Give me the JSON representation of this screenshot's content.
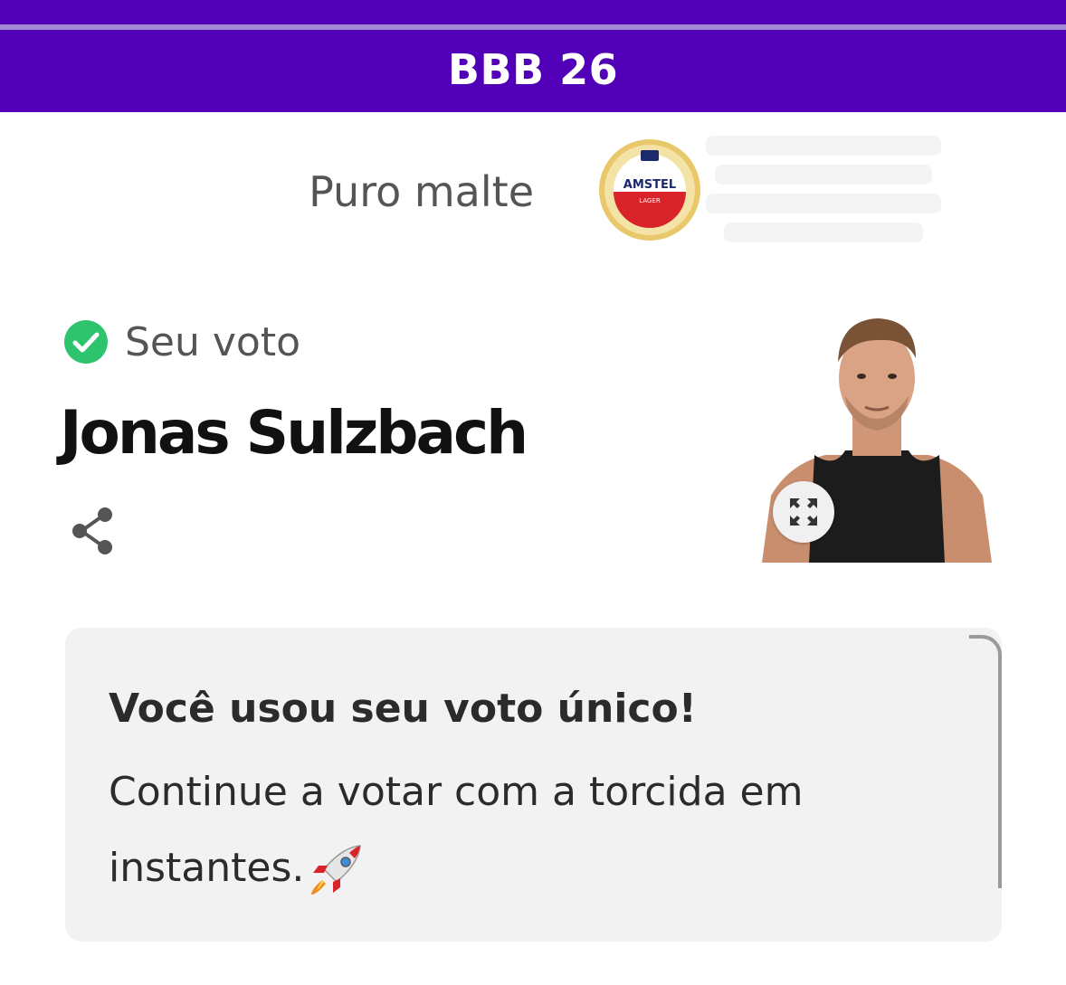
{
  "header": {
    "title": "BBB 26",
    "accent_color": "#5200b8"
  },
  "sponsor": {
    "tagline": "Puro malte",
    "logo_text": "AMSTEL",
    "logo_subtext": "LAGER"
  },
  "vote": {
    "status_label": "Seu voto",
    "status_icon": "check-circle-icon",
    "status_color": "#2ec46e",
    "candidate_name": "Jonas Sulzbach"
  },
  "actions": {
    "share_icon": "share-icon",
    "expand_icon": "expand-icon"
  },
  "notice": {
    "title": "Você usou seu voto único!",
    "body": "Continue a votar com a torcida em instantes.",
    "emoji": "rocket-icon"
  }
}
